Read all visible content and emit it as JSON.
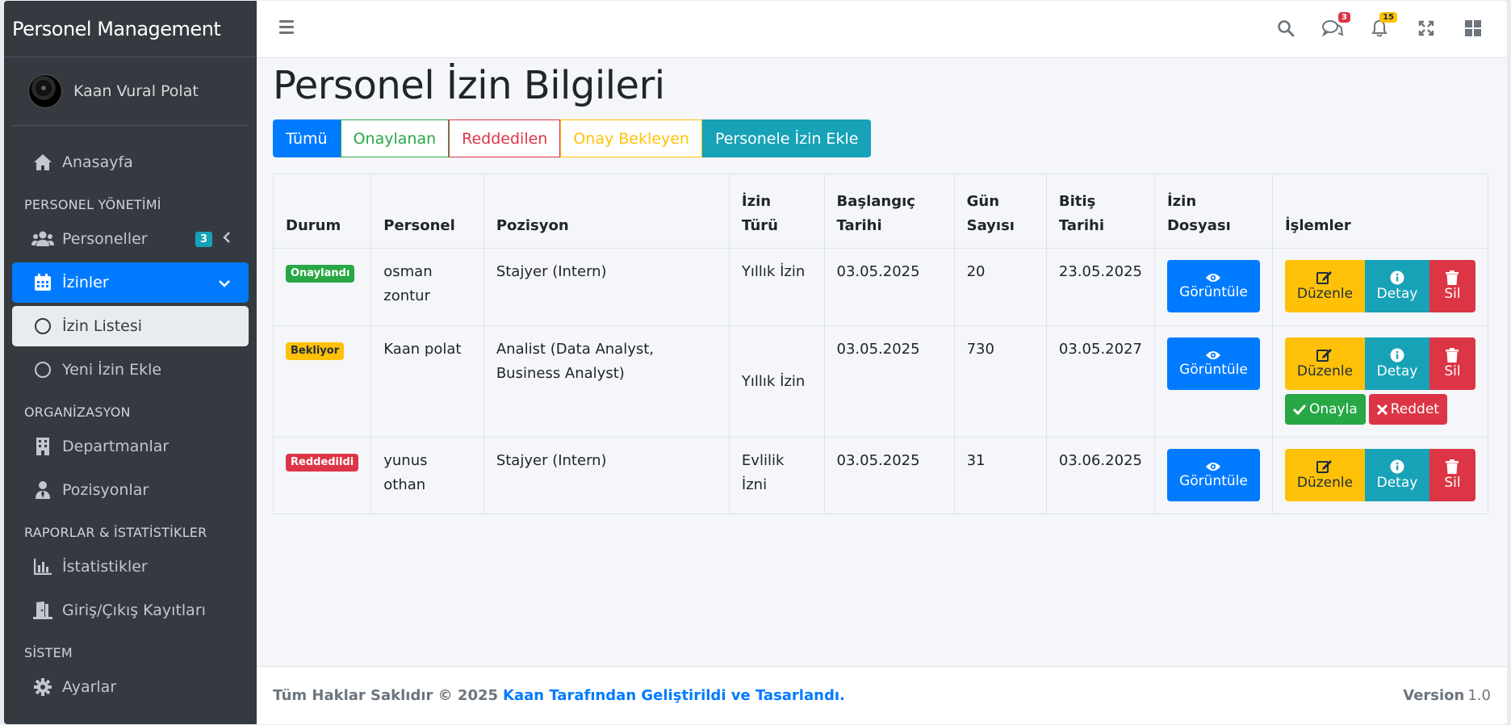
{
  "brand": "Personel Management",
  "user": {
    "name": "Kaan Vural Polat"
  },
  "sidebar": {
    "home": "Anasayfa",
    "header_personnel": "PERSONEL YÖNETİMİ",
    "personnel": "Personeller",
    "personnel_badge": "3",
    "leaves": "İzinler",
    "leave_list": "İzin Listesi",
    "new_leave": "Yeni İzin Ekle",
    "header_org": "ORGANİZASYON",
    "departments": "Departmanlar",
    "positions": "Pozisyonlar",
    "header_reports": "RAPORLAR & İSTATİSTİKLER",
    "statistics": "İstatistikler",
    "entry_exit": "Giriş/Çıkış Kayıtları",
    "header_system": "SİSTEM",
    "settings": "Ayarlar"
  },
  "topbar": {
    "messages_count": "3",
    "notifications_count": "15"
  },
  "page": {
    "title": "Personel İzin Bilgileri"
  },
  "filters": {
    "all": "Tümü",
    "approved": "Onaylanan",
    "rejected": "Reddedilen",
    "pending": "Onay Bekleyen",
    "add": "Personele İzin Ekle"
  },
  "table": {
    "headers": {
      "status": "Durum",
      "personnel": "Personel",
      "position": "Pozisyon",
      "leave_type": "İzin Türü",
      "start_date": "Başlangıç Tarihi",
      "days": "Gün Sayısı",
      "end_date": "Bitiş Tarihi",
      "file": "İzin Dosyası",
      "actions": "İşlemler"
    },
    "rows": [
      {
        "status": "Onaylandı",
        "personnel": "osman zontur",
        "position": "Stajyer (Intern)",
        "leave_type": "Yıllık İzin",
        "start": "03.05.2025",
        "days": "20",
        "end": "23.05.2025"
      },
      {
        "status": "Bekliyor",
        "personnel": "Kaan polat",
        "position": "Analist (Data Analyst, Business Analyst)",
        "leave_type": "Yıllık İzin",
        "start": "03.05.2025",
        "days": "730",
        "end": "03.05.2027"
      },
      {
        "status": "Reddedildi",
        "personnel": "yunus othan",
        "position": "Stajyer (Intern)",
        "leave_type": "Evlilik İzni",
        "start": "03.05.2025",
        "days": "31",
        "end": "03.06.2025"
      }
    ],
    "view_label": "Görüntüle",
    "edit_label": "Düzenle",
    "detail_label": "Detay",
    "delete_label": "Sil",
    "approve_label": "Onayla",
    "reject_label": "Reddet"
  },
  "footer": {
    "copyright": "Tüm Haklar Saklıdır © 2025",
    "credit": "Kaan Tarafından Geliştirildi ve Tasarlandı.",
    "version_label": "Version",
    "version": "1.0"
  }
}
